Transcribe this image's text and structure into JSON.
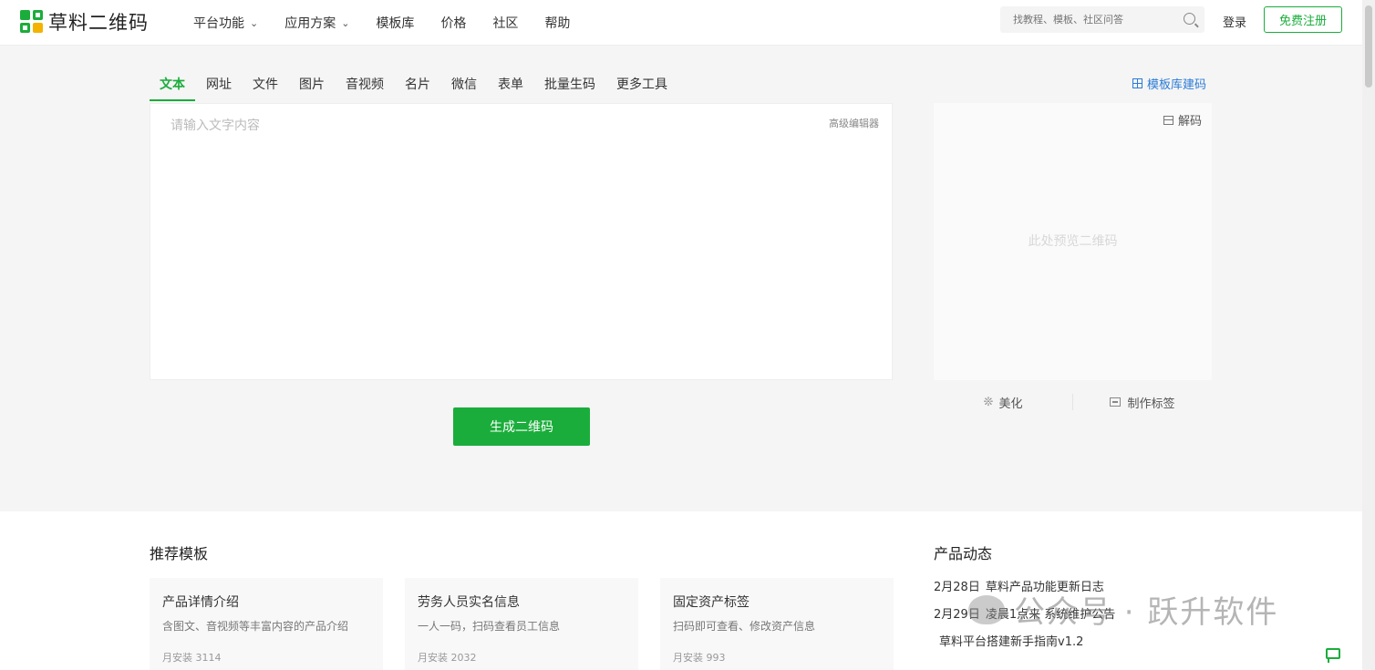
{
  "brand": {
    "name": "草料二维码",
    "colors": {
      "primary": "#1aad3b",
      "accent": "#f3b300",
      "link": "#2b7bd6"
    }
  },
  "nav": {
    "items": [
      {
        "label": "平台功能",
        "dropdown": true
      },
      {
        "label": "应用方案",
        "dropdown": true
      },
      {
        "label": "模板库",
        "dropdown": false
      },
      {
        "label": "价格",
        "dropdown": false
      },
      {
        "label": "社区",
        "dropdown": false
      },
      {
        "label": "帮助",
        "dropdown": false
      }
    ],
    "chevron": "⌄"
  },
  "search": {
    "placeholder": "找教程、模板、社区问答"
  },
  "auth": {
    "login": "登录",
    "register": "免费注册"
  },
  "tabs": {
    "items": [
      "文本",
      "网址",
      "文件",
      "图片",
      "音视频",
      "名片",
      "微信",
      "表单",
      "批量生码",
      "更多工具"
    ],
    "active": 0
  },
  "template_link": "模板库建码",
  "editor": {
    "placeholder": "请输入文字内容",
    "advanced": "高级编辑器",
    "value": ""
  },
  "generate_button": "生成二维码",
  "preview": {
    "decode": "解码",
    "placeholder": "此处预览二维码",
    "beautify": "美化",
    "beautify_icon": "❊",
    "make_label": "制作标签"
  },
  "recommended": {
    "title": "推荐模板",
    "cards": [
      {
        "title": "产品详情介绍",
        "desc": "含图文、音视频等丰富内容的产品介绍",
        "installs": "月安装 3114"
      },
      {
        "title": "劳务人员实名信息",
        "desc": "一人一码，扫码查看员工信息",
        "installs": "月安装 2032"
      },
      {
        "title": "固定资产标签",
        "desc": "扫码即可查看、修改资产信息",
        "installs": "月安装 993"
      }
    ]
  },
  "updates": {
    "title": "产品动态",
    "items": [
      {
        "date": "2月28日",
        "text": "草料产品功能更新日志"
      },
      {
        "date": "2月29日",
        "text": "凌晨1点来 系统维护公告"
      },
      {
        "date": "",
        "text": "草料平台搭建新手指南v1.2"
      }
    ]
  },
  "watermark": "公众号 · 跃升软件"
}
